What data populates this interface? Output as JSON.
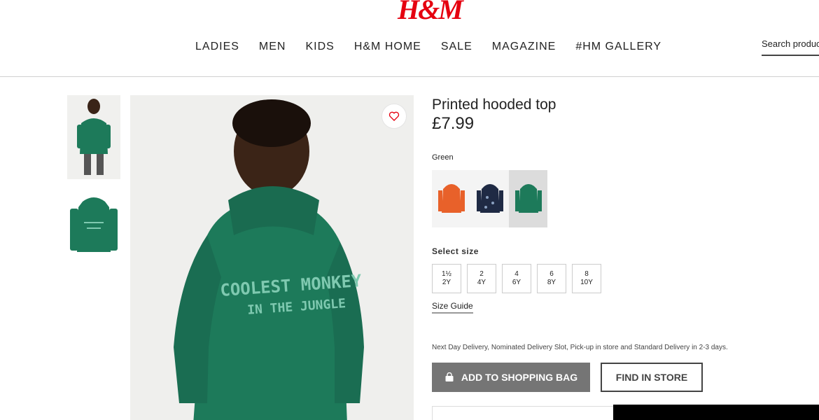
{
  "header": {
    "logo": "H&M",
    "nav": [
      "LADIES",
      "MEN",
      "KIDS",
      "H&M HOME",
      "SALE",
      "MAGAZINE",
      "#HM GALLERY"
    ],
    "search_placeholder": "Search products"
  },
  "product": {
    "title": "Printed hooded top",
    "price": "£7.99",
    "color_label": "Green",
    "hoodie_print_line1": "COOLEST MONKEY",
    "hoodie_print_line2": "IN THE JUNGLE",
    "swatches": [
      {
        "name": "orange",
        "color": "#e8612a"
      },
      {
        "name": "navy",
        "color": "#1f2a44"
      },
      {
        "name": "green",
        "color": "#1d7a5a",
        "selected": true
      }
    ],
    "size_label": "Select size",
    "sizes": [
      {
        "top": "1½",
        "bottom": "2Y"
      },
      {
        "top": "2",
        "bottom": "4Y"
      },
      {
        "top": "4",
        "bottom": "6Y"
      },
      {
        "top": "6",
        "bottom": "8Y"
      },
      {
        "top": "8",
        "bottom": "10Y"
      }
    ],
    "size_guide": "Size Guide",
    "delivery": "Next Day Delivery, Nominated Delivery Slot, Pick-up in store and Standard Delivery in 2-3 days.",
    "add_to_bag": "ADD TO SHOPPING BAG",
    "find_in_store": "FIND IN STORE"
  },
  "colors": {
    "brand_red": "#e50010",
    "hoodie_green": "#1d7a5a",
    "button_grey": "#757575"
  }
}
